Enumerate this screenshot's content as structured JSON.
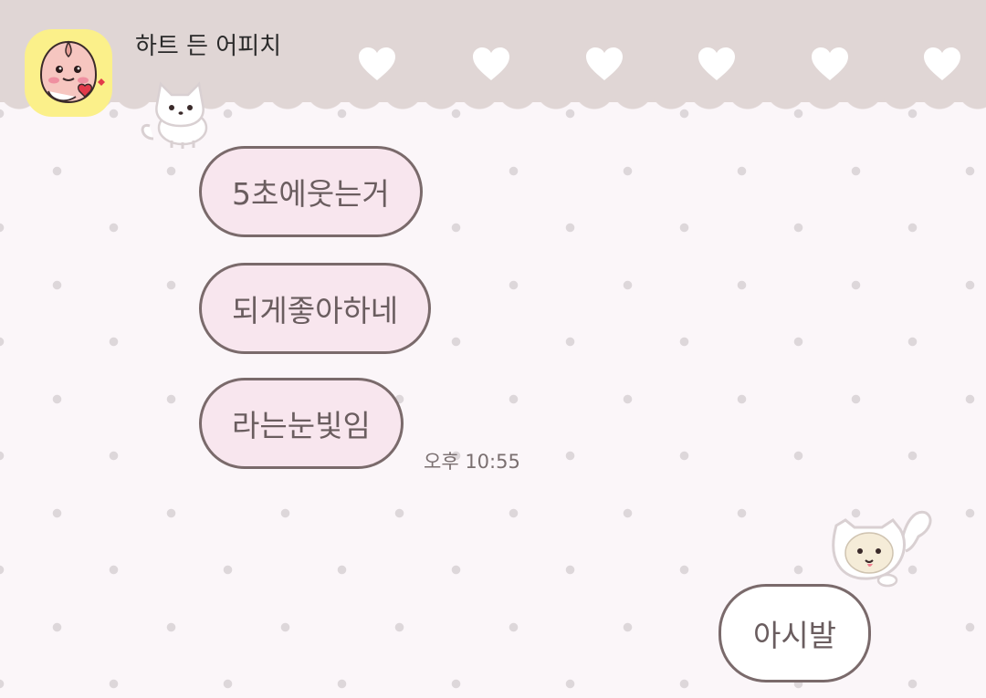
{
  "chat": {
    "title": "하트 든 어피치"
  },
  "messages": {
    "incoming": [
      {
        "text": "5초에웃는거"
      },
      {
        "text": "되게좋아하네"
      },
      {
        "text": "라는눈빛임"
      }
    ],
    "incoming_time": "오후 10:55",
    "outgoing": [
      {
        "text": "아시발"
      }
    ]
  },
  "theme": {
    "header_color": "#e0d6d5",
    "background_color": "#fbf6f9",
    "incoming_bubble_color": "#f8e6ee",
    "outgoing_bubble_color": "#ffffff",
    "bubble_border_color": "#7a6a6b"
  },
  "icons": {
    "avatar": "apeach-with-heart-icon",
    "header_decoration": "heart-icon",
    "top_sticker": "white-kitten-icon",
    "bottom_sticker": "cream-kitten-icon"
  }
}
